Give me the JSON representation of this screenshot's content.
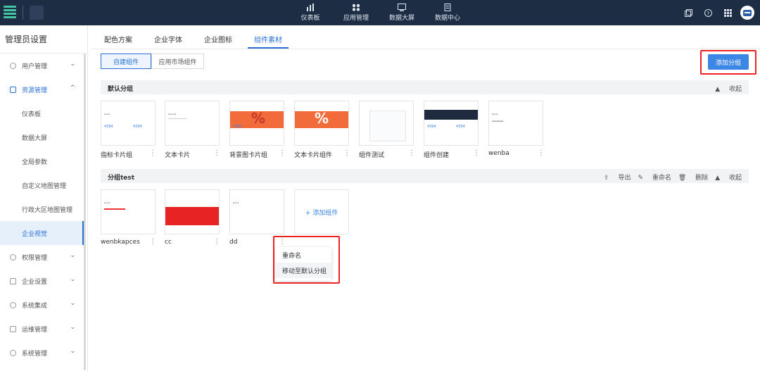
{
  "topnav": {
    "items": [
      {
        "label": "仪表板",
        "icon": "bar-chart-icon"
      },
      {
        "label": "应用管理",
        "icon": "apps-icon"
      },
      {
        "label": "数据大屏",
        "icon": "screen-icon"
      },
      {
        "label": "数据中心",
        "icon": "database-icon"
      }
    ]
  },
  "sidebar": {
    "title": "管理员设置",
    "items": [
      {
        "label": "用户管理",
        "type": "group",
        "state": "collapsed"
      },
      {
        "label": "资源管理",
        "type": "group",
        "state": "expanded"
      },
      {
        "label": "仪表板",
        "type": "sub"
      },
      {
        "label": "数据大屏",
        "type": "sub"
      },
      {
        "label": "全局参数",
        "type": "sub"
      },
      {
        "label": "自定义地图管理",
        "type": "sub"
      },
      {
        "label": "行政大区地图管理",
        "type": "sub"
      },
      {
        "label": "企业视觉",
        "type": "sub",
        "active": true
      },
      {
        "label": "权限管理",
        "type": "group",
        "state": "collapsed"
      },
      {
        "label": "企业设置",
        "type": "group",
        "state": "collapsed"
      },
      {
        "label": "系统集成",
        "type": "group",
        "state": "collapsed"
      },
      {
        "label": "运维管理",
        "type": "group",
        "state": "collapsed"
      },
      {
        "label": "系统管理",
        "type": "group",
        "state": "collapsed"
      }
    ]
  },
  "tabs": {
    "items": [
      "配色方案",
      "企业字体",
      "企业图标",
      "组件素材"
    ],
    "active": "组件素材"
  },
  "segment": {
    "self": "自建组件",
    "market": "应用市场组件"
  },
  "add_group_label": "添加分组",
  "default_group": {
    "title": "默认分组",
    "collapse": "收起",
    "cards": [
      "指标卡片组",
      "文本卡片",
      "背景图卡片组",
      "文本卡片组件",
      "组件测试",
      "组件创建",
      "wenba"
    ]
  },
  "test_group": {
    "title": "分组test",
    "actions": {
      "export": "导出",
      "rename": "重命名",
      "delete": "删除",
      "collapse": "收起"
    },
    "cards": [
      "wenbkapces",
      "cc",
      "dd"
    ],
    "add_component": "+ 添加组件"
  },
  "context_menu": {
    "rename": "重命名",
    "move": "移动至默认分组"
  },
  "colors": {
    "accent": "#3c86e6",
    "topbar": "#1d2d44",
    "highlight_box": "#e22222",
    "percent_card": "#f26b3a"
  }
}
